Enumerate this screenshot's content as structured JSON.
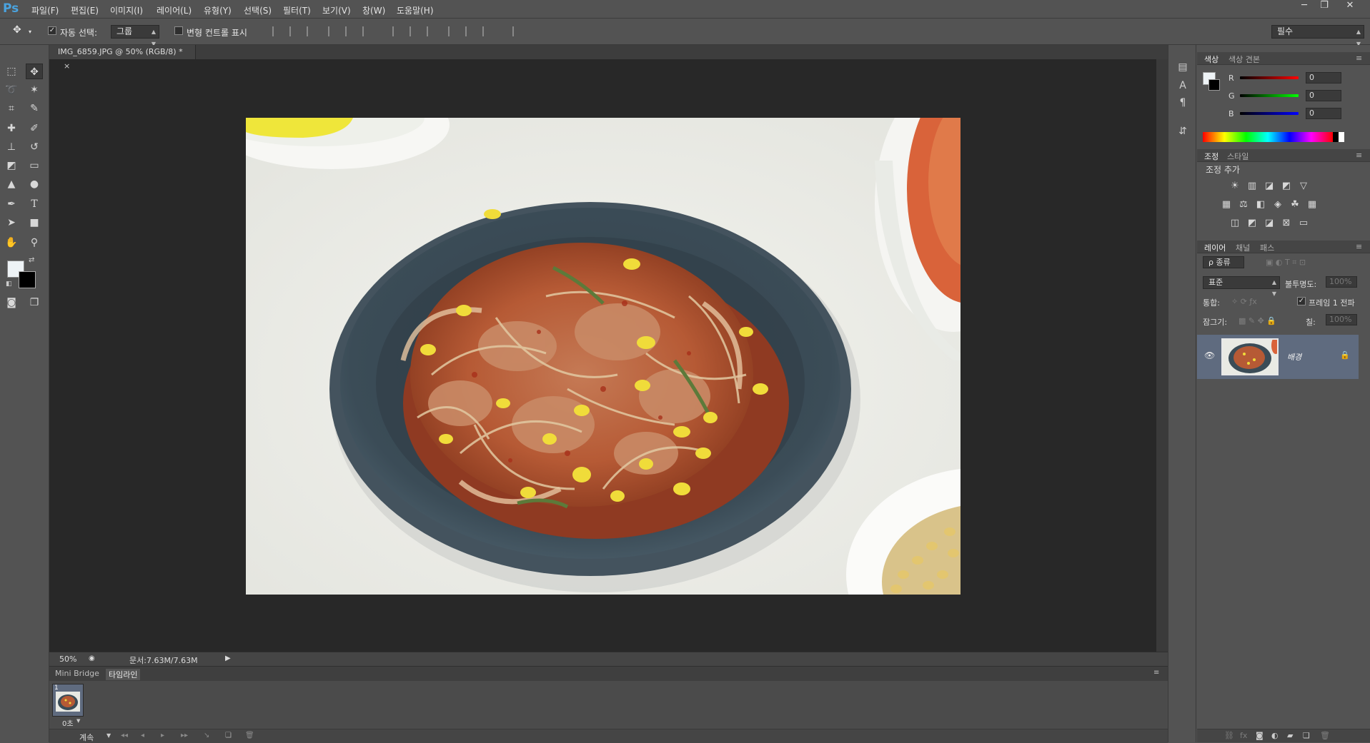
{
  "app": {
    "logo": "Ps"
  },
  "menu": [
    "파일(F)",
    "편집(E)",
    "이미지(I)",
    "레이어(L)",
    "유형(Y)",
    "선택(S)",
    "필터(T)",
    "보기(V)",
    "창(W)",
    "도움말(H)"
  ],
  "window_controls": {
    "minimize": "─",
    "restore": "❐",
    "close": "✕"
  },
  "options": {
    "move_icon": "✥",
    "auto_select_label": "자동 선택:",
    "auto_select_checked": "✓",
    "auto_select_value": "그룹",
    "transform_controls_label": "변형 컨트롤 표시",
    "workspace": "필수"
  },
  "document": {
    "tab_title": "IMG_6859.JPG @ 50% (RGB/8) *",
    "tab_close": "×",
    "zoom": "50%",
    "doc_size": "문서:7.63M/7.63M"
  },
  "bottom_panel": {
    "tabs": [
      "Mini Bridge",
      "타임라인"
    ],
    "frame_number": "1",
    "frame_delay": "0초",
    "loop_option": "계속"
  },
  "color_panel": {
    "tabs": [
      "색상",
      "색상 견본"
    ],
    "channels": [
      {
        "label": "R",
        "value": "0"
      },
      {
        "label": "G",
        "value": "0"
      },
      {
        "label": "B",
        "value": "0"
      }
    ],
    "foreground": "#eef3f6",
    "background": "#000000"
  },
  "adjustments_panel": {
    "tabs": [
      "조정",
      "스타일"
    ],
    "title": "조정 추가"
  },
  "layers_panel": {
    "tabs": [
      "레이어",
      "채널",
      "패스"
    ],
    "filter_kind": "ρ 종류",
    "blend_mode": "표준",
    "opacity_label": "불투명도:",
    "opacity_value": "100%",
    "unify_label": "통합:",
    "propagate_label": "프레임 1 전파",
    "lock_label": "잠그기:",
    "fill_label": "칠:",
    "fill_value": "100%",
    "layer_name": "배경"
  },
  "colors": {
    "accent_layer": "#5f6b7f",
    "canvas_bg": "#282828",
    "panel_bg": "#535353"
  }
}
